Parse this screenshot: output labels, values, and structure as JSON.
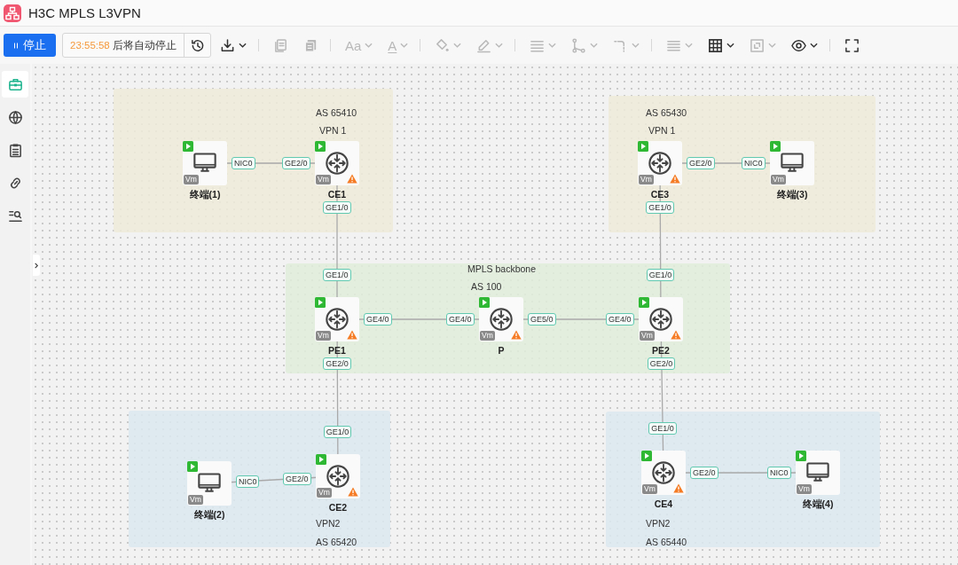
{
  "window": {
    "title": "H3C MPLS L3VPN"
  },
  "toolbar": {
    "stop_button": {
      "label": "停止"
    },
    "timer": {
      "time": "23:55:58",
      "suffix": "后将自动停止"
    },
    "tools": [
      {
        "kind": "history",
        "disabled": false,
        "dropdown": false
      },
      {
        "kind": "download",
        "disabled": false,
        "dropdown": true
      },
      {
        "kind": "separator"
      },
      {
        "kind": "copy",
        "disabled": true,
        "dropdown": false
      },
      {
        "kind": "paste",
        "disabled": true,
        "dropdown": false
      },
      {
        "kind": "separator"
      },
      {
        "kind": "font-size",
        "glyph": "Aa",
        "disabled": true,
        "dropdown": true
      },
      {
        "kind": "font-color",
        "glyph": "A",
        "disabled": true,
        "dropdown": true
      },
      {
        "kind": "separator"
      },
      {
        "kind": "fill",
        "disabled": true,
        "dropdown": true
      },
      {
        "kind": "pen",
        "disabled": true,
        "dropdown": true
      },
      {
        "kind": "separator"
      },
      {
        "kind": "line-weight",
        "disabled": true,
        "dropdown": true
      },
      {
        "kind": "connector",
        "disabled": true,
        "dropdown": true
      },
      {
        "kind": "corner",
        "disabled": true,
        "dropdown": true
      },
      {
        "kind": "separator"
      },
      {
        "kind": "align",
        "disabled": true,
        "dropdown": true
      },
      {
        "kind": "grid",
        "disabled": false,
        "dropdown": true
      },
      {
        "kind": "resize",
        "disabled": true,
        "dropdown": true
      },
      {
        "kind": "eye",
        "disabled": false,
        "dropdown": true
      },
      {
        "kind": "separator"
      },
      {
        "kind": "fullscreen",
        "disabled": false,
        "dropdown": false
      }
    ]
  },
  "sidebar": {
    "items": [
      {
        "kind": "toolbox",
        "selected": true
      },
      {
        "kind": "globe",
        "selected": false
      },
      {
        "kind": "clipboard",
        "selected": false
      },
      {
        "kind": "link",
        "selected": false
      },
      {
        "kind": "search-list",
        "selected": false
      }
    ]
  },
  "canvas": {
    "zones": [
      {
        "color": "#efebdb",
        "labels": [
          "AS 65410",
          "VPN 1"
        ]
      },
      {
        "color": "#efebdb",
        "labels": [
          "AS 65430",
          "VPN 1"
        ]
      },
      {
        "color": "#e1eddc",
        "labels": [
          "MPLS backbone",
          "AS 100"
        ]
      },
      {
        "color": "#dce8f0",
        "labels": [
          "VPN2",
          "AS 65420"
        ]
      },
      {
        "color": "#dce8f0",
        "labels": [
          "VPN2",
          "AS 65440"
        ]
      }
    ],
    "nodes": [
      {
        "kind": "terminal",
        "name": "终端(1)",
        "running": true,
        "warning": false,
        "badge": "Vm"
      },
      {
        "kind": "router",
        "name": "CE1",
        "running": true,
        "warning": true,
        "badge": "Vm"
      },
      {
        "kind": "router",
        "name": "CE3",
        "running": true,
        "warning": true,
        "badge": "Vm"
      },
      {
        "kind": "terminal",
        "name": "终端(3)",
        "running": true,
        "warning": false,
        "badge": "Vm"
      },
      {
        "kind": "router",
        "name": "PE1",
        "running": true,
        "warning": true,
        "badge": "Vm"
      },
      {
        "kind": "router",
        "name": "P",
        "running": true,
        "warning": true,
        "badge": "Vm"
      },
      {
        "kind": "router",
        "name": "PE2",
        "running": true,
        "warning": true,
        "badge": "Vm"
      },
      {
        "kind": "terminal",
        "name": "终端(2)",
        "running": true,
        "warning": false,
        "badge": "Vm"
      },
      {
        "kind": "router",
        "name": "CE2",
        "running": true,
        "warning": true,
        "badge": "Vm"
      },
      {
        "kind": "router",
        "name": "CE4",
        "running": true,
        "warning": true,
        "badge": "Vm"
      },
      {
        "kind": "terminal",
        "name": "终端(4)",
        "running": true,
        "warning": false,
        "badge": "Vm"
      }
    ],
    "links": [
      {
        "ports": [
          "NIC0",
          "GE2/0"
        ]
      },
      {
        "ports": [
          "GE1/0",
          "GE1/0"
        ]
      },
      {
        "ports": [
          "GE2/0",
          "NIC0"
        ]
      },
      {
        "ports": [
          "GE1/0",
          "GE1/0"
        ]
      },
      {
        "ports": [
          "GE4/0",
          "GE4/0"
        ]
      },
      {
        "ports": [
          "GE5/0",
          "GE4/0"
        ]
      },
      {
        "ports": [
          "GE2/0",
          "GE1/0"
        ]
      },
      {
        "ports": [
          "GE2/0",
          "NIC0"
        ]
      },
      {
        "ports": [
          "GE2/0",
          "GE1/0"
        ]
      },
      {
        "ports": [
          "GE2/0",
          "NIC0"
        ]
      }
    ]
  }
}
